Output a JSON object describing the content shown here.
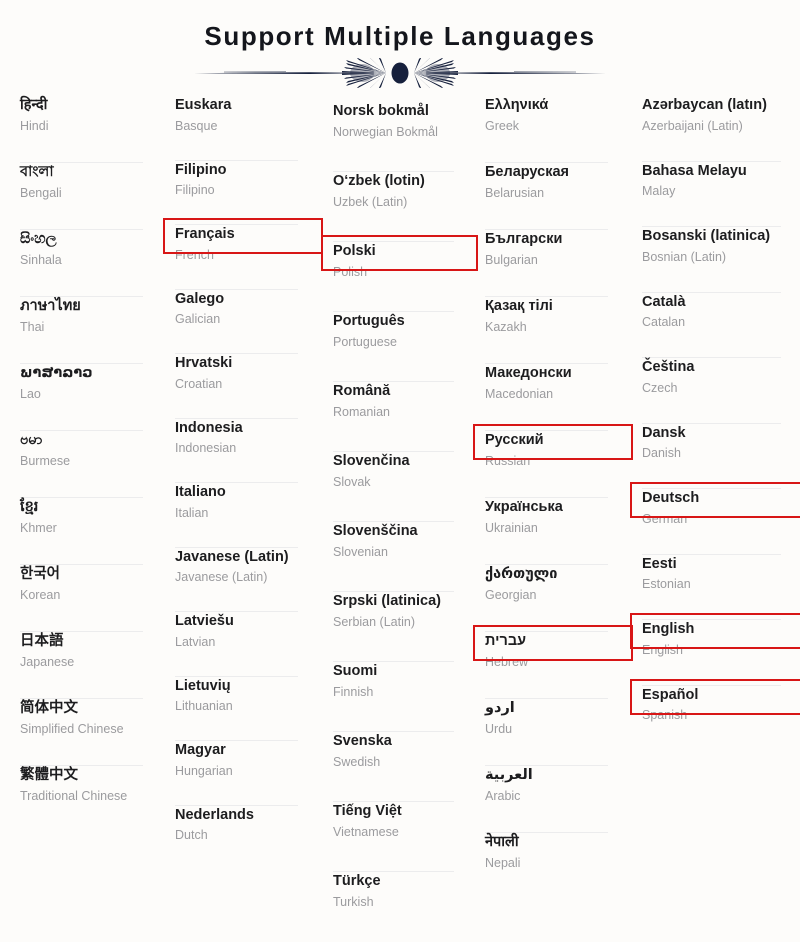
{
  "header": {
    "title": "Support Multiple Languages",
    "divider_icon": "ornamental-divider-icon"
  },
  "colors": {
    "background": "#fdfcfa",
    "title": "#14161c",
    "native_text": "#1d1d1f",
    "english_text": "#9b9b9e",
    "row_divider": "#ececed",
    "highlight_border": "#d81616",
    "divider_ornament": "#16203c"
  },
  "columns": [
    {
      "id": "column-1",
      "items": [
        {
          "native": "हिन्दी",
          "english": "Hindi",
          "highlighted": false
        },
        {
          "native": "বাংলা",
          "english": "Bengali",
          "highlighted": false
        },
        {
          "native": "සිංහල",
          "english": "Sinhala",
          "highlighted": false
        },
        {
          "native": "ภาษาไทย",
          "english": "Thai",
          "highlighted": false
        },
        {
          "native": "ພາສາລາວ",
          "english": "Lao",
          "highlighted": false
        },
        {
          "native": "ဗမာ",
          "english": "Burmese",
          "highlighted": false
        },
        {
          "native": "ខ្មែរ",
          "english": "Khmer",
          "highlighted": false
        },
        {
          "native": "한국어",
          "english": "Korean",
          "highlighted": false
        },
        {
          "native": "日本語",
          "english": "Japanese",
          "highlighted": false
        },
        {
          "native": "简体中文",
          "english": "Simplified Chinese",
          "highlighted": false
        },
        {
          "native": "繁體中文",
          "english": "Traditional Chinese",
          "highlighted": false
        }
      ]
    },
    {
      "id": "column-2",
      "items": [
        {
          "native": "Euskara",
          "english": "Basque",
          "highlighted": false
        },
        {
          "native": "Filipino",
          "english": "Filipino",
          "highlighted": false
        },
        {
          "native": "Français",
          "english": "French",
          "highlighted": true
        },
        {
          "native": "Galego",
          "english": "Galician",
          "highlighted": false
        },
        {
          "native": "Hrvatski",
          "english": "Croatian",
          "highlighted": false
        },
        {
          "native": "Indonesia",
          "english": "Indonesian",
          "highlighted": false
        },
        {
          "native": "Italiano",
          "english": "Italian",
          "highlighted": false
        },
        {
          "native": "Javanese (Latin)",
          "english": "Javanese (Latin)",
          "highlighted": false
        },
        {
          "native": "Latviešu",
          "english": "Latvian",
          "highlighted": false
        },
        {
          "native": "Lietuvių",
          "english": "Lithuanian",
          "highlighted": false
        },
        {
          "native": "Magyar",
          "english": "Hungarian",
          "highlighted": false
        },
        {
          "native": "Nederlands",
          "english": "Dutch",
          "highlighted": false
        }
      ]
    },
    {
      "id": "column-3",
      "items": [
        {
          "native": "Norsk bokmål",
          "english": "Norwegian Bokmål",
          "highlighted": false
        },
        {
          "native": "O‘zbek (lotin)",
          "english": "Uzbek (Latin)",
          "highlighted": false
        },
        {
          "native": "Polski",
          "english": "Polish",
          "highlighted": true
        },
        {
          "native": "Português",
          "english": "Portuguese",
          "highlighted": false
        },
        {
          "native": "Română",
          "english": "Romanian",
          "highlighted": false
        },
        {
          "native": "Slovenčina",
          "english": "Slovak",
          "highlighted": false
        },
        {
          "native": "Slovenščina",
          "english": "Slovenian",
          "highlighted": false
        },
        {
          "native": "Srpski (latinica)",
          "english": "Serbian (Latin)",
          "highlighted": false
        },
        {
          "native": "Suomi",
          "english": "Finnish",
          "highlighted": false
        },
        {
          "native": "Svenska",
          "english": "Swedish",
          "highlighted": false
        },
        {
          "native": "Tiếng Việt",
          "english": "Vietnamese",
          "highlighted": false
        },
        {
          "native": "Türkçe",
          "english": "Turkish",
          "highlighted": false
        }
      ]
    },
    {
      "id": "column-4",
      "items": [
        {
          "native": "Ελληνικά",
          "english": "Greek",
          "highlighted": false
        },
        {
          "native": "Беларуская",
          "english": "Belarusian",
          "highlighted": false
        },
        {
          "native": "Български",
          "english": "Bulgarian",
          "highlighted": false
        },
        {
          "native": "Қазақ тілі",
          "english": "Kazakh",
          "highlighted": false
        },
        {
          "native": "Македонски",
          "english": "Macedonian",
          "highlighted": false
        },
        {
          "native": "Русский",
          "english": "Russian",
          "highlighted": true
        },
        {
          "native": "Українська",
          "english": "Ukrainian",
          "highlighted": false
        },
        {
          "native": "ქართული",
          "english": "Georgian",
          "highlighted": false
        },
        {
          "native": "עברית",
          "english": "Hebrew",
          "highlighted": true
        },
        {
          "native": "اردو",
          "english": "Urdu",
          "highlighted": false
        },
        {
          "native": "العربية",
          "english": "Arabic",
          "highlighted": false
        },
        {
          "native": "नेपाली",
          "english": "Nepali",
          "highlighted": false
        }
      ]
    },
    {
      "id": "column-5",
      "items": [
        {
          "native": "Azərbaycan (latın)",
          "english": "Azerbaijani (Latin)",
          "highlighted": false
        },
        {
          "native": "Bahasa Melayu",
          "english": "Malay",
          "highlighted": false
        },
        {
          "native": "Bosanski (latinica)",
          "english": "Bosnian (Latin)",
          "highlighted": false
        },
        {
          "native": "Català",
          "english": "Catalan",
          "highlighted": false
        },
        {
          "native": "Čeština",
          "english": "Czech",
          "highlighted": false
        },
        {
          "native": "Dansk",
          "english": "Danish",
          "highlighted": false
        },
        {
          "native": "Deutsch",
          "english": "German",
          "highlighted": true
        },
        {
          "native": "Eesti",
          "english": "Estonian",
          "highlighted": false
        },
        {
          "native": "English",
          "english": "English",
          "highlighted": true
        },
        {
          "native": "Español",
          "english": "Spanish",
          "highlighted": true
        }
      ]
    }
  ]
}
